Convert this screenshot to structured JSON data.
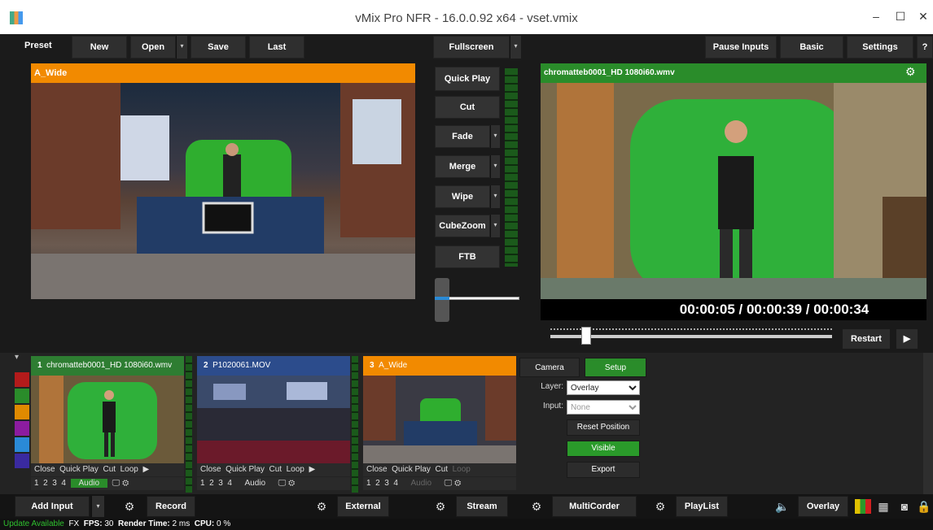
{
  "window": {
    "title": "vMix Pro NFR - 16.0.0.92 x64 - vset.vmix"
  },
  "toolbar": {
    "preset": "Preset",
    "new": "New",
    "open": "Open",
    "save": "Save",
    "last": "Last",
    "fullscreen": "Fullscreen",
    "pause_inputs": "Pause Inputs",
    "basic": "Basic",
    "settings": "Settings",
    "help": "?"
  },
  "preview": {
    "title": "A_Wide"
  },
  "transitions": {
    "quick_play": "Quick Play",
    "cut": "Cut",
    "fade": "Fade",
    "merge": "Merge",
    "wipe": "Wipe",
    "cubezoom": "CubeZoom",
    "ftb": "FTB"
  },
  "output": {
    "title": "chromatteb0001_HD 1080i60.wmv",
    "timecode": "00:00:05 / 00:00:39 / 00:00:34",
    "restart": "Restart"
  },
  "inputs": [
    {
      "number": "1",
      "name": "chromatteb0001_HD 1080i60.wmv",
      "color": "#2e7d32"
    },
    {
      "number": "2",
      "name": "P1020061.MOV",
      "color": "#2c4c8c"
    },
    {
      "number": "3",
      "name": "A_Wide",
      "color": "#f28a00"
    }
  ],
  "input_controls": {
    "close": "Close",
    "quick_play": "Quick Play",
    "cut": "Cut",
    "loop": "Loop",
    "n1": "1",
    "n2": "2",
    "n3": "3",
    "n4": "4",
    "audio": "Audio"
  },
  "color_tags": [
    "#b31b1b",
    "#2a8c2a",
    "#e08a00",
    "#8c1ca0",
    "#2a8ad6",
    "#3a2aa0"
  ],
  "layer_panel": {
    "camera_tab": "Camera",
    "setup_tab": "Setup",
    "layer_label": "Layer:",
    "layer_value": "Overlay",
    "input_label": "Input:",
    "input_value": "None",
    "reset_position": "Reset Position",
    "visible": "Visible",
    "export": "Export"
  },
  "footer": {
    "add_input": "Add Input",
    "record": "Record",
    "external": "External",
    "stream": "Stream",
    "multicorder": "MultiCorder",
    "playlist": "PlayList",
    "overlay": "Overlay"
  },
  "status": {
    "update": "Update Available",
    "fx": "FX",
    "fps_label": "FPS:",
    "fps": "30",
    "render_label": "Render Time:",
    "render": "2 ms",
    "cpu_label": "CPU:",
    "cpu": "0 %"
  }
}
